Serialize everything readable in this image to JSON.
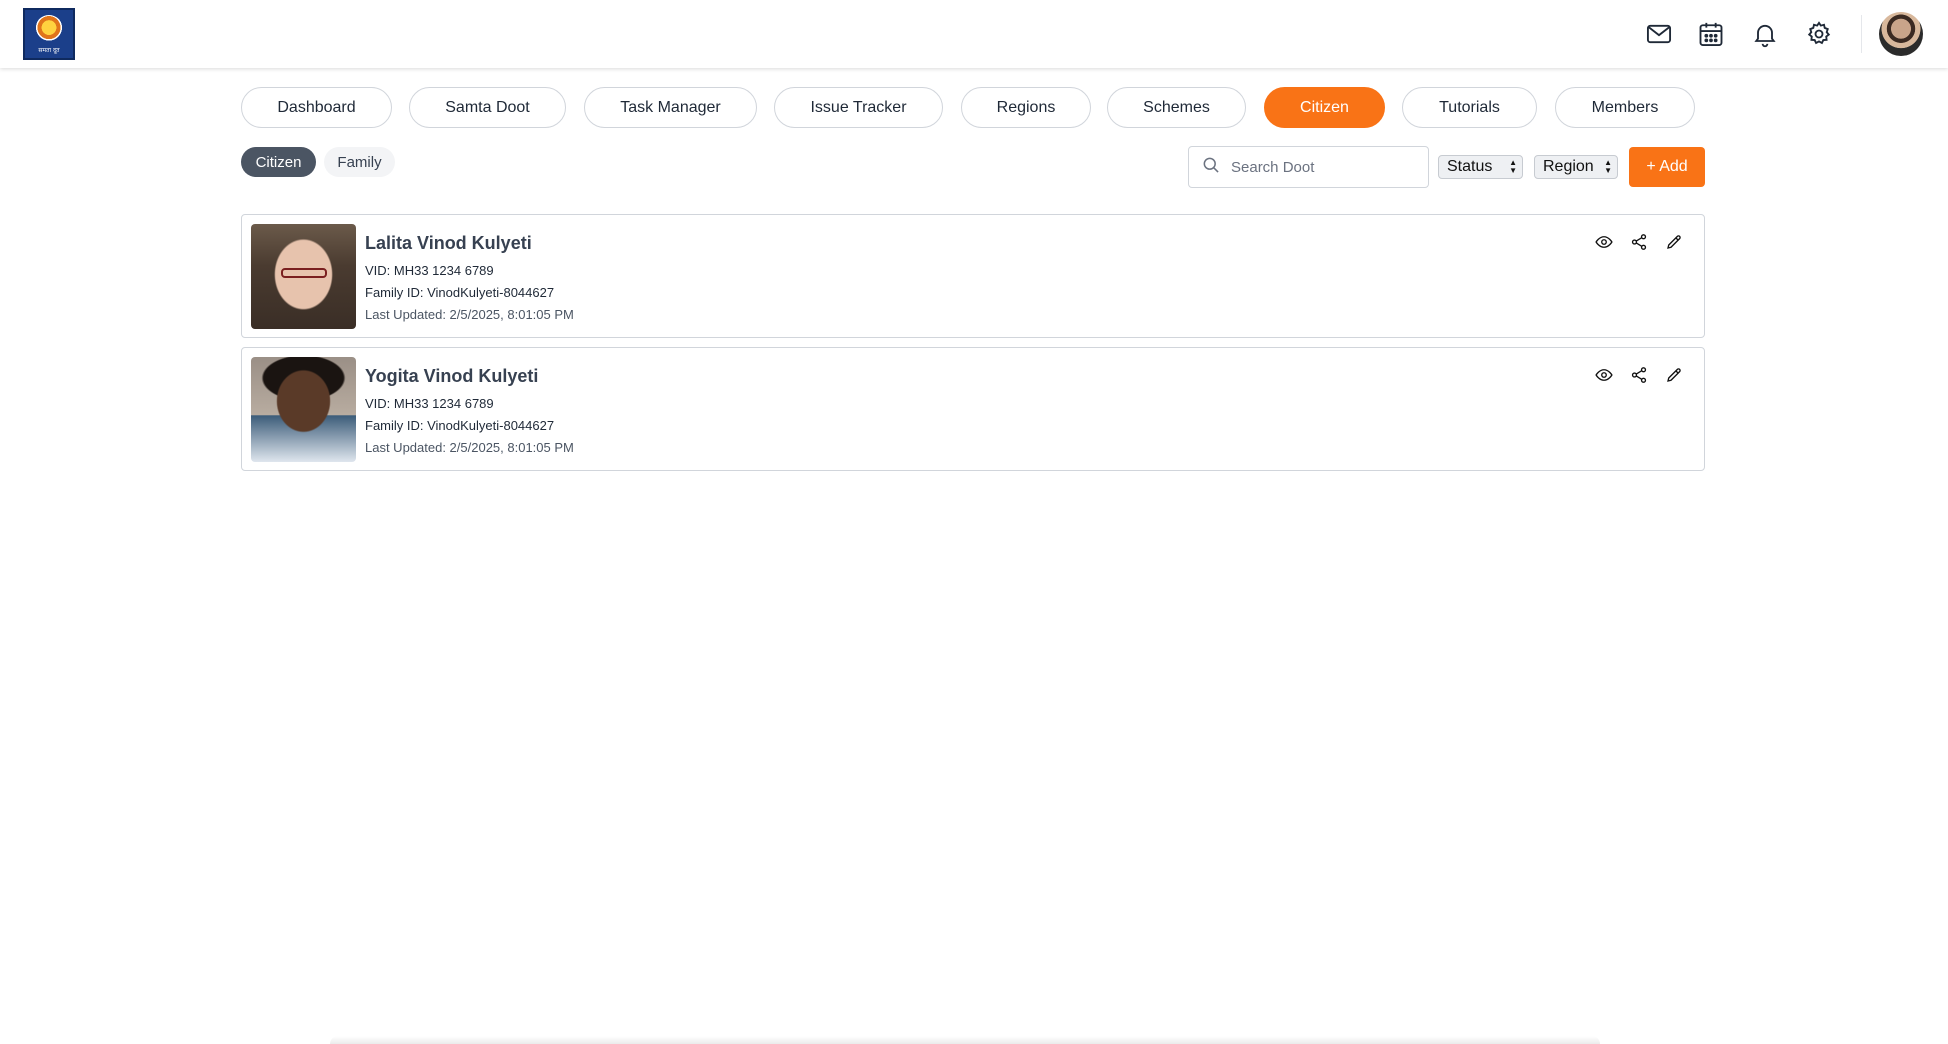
{
  "header": {
    "logo_text": "समता दूत",
    "icons": [
      "mail-icon",
      "calendar-icon",
      "bell-icon",
      "gear-icon"
    ]
  },
  "nav": {
    "tabs": [
      {
        "label": "Dashboard",
        "active": false
      },
      {
        "label": "Samta Doot",
        "active": false
      },
      {
        "label": "Task Manager",
        "active": false
      },
      {
        "label": "Issue Tracker",
        "active": false
      },
      {
        "label": "Regions",
        "active": false
      },
      {
        "label": "Schemes",
        "active": false
      },
      {
        "label": "Citizen",
        "active": true
      },
      {
        "label": "Tutorials",
        "active": false
      },
      {
        "label": "Members",
        "active": false
      }
    ]
  },
  "subtabs": [
    {
      "label": "Citizen",
      "active": true
    },
    {
      "label": "Family",
      "active": false
    }
  ],
  "toolbar": {
    "search_placeholder": "Search Doot",
    "status_label": "Status",
    "region_label": "Region",
    "add_label": "+ Add"
  },
  "citizens": [
    {
      "name": "Lalita Vinod Kulyeti",
      "vid": "VID: MH33 1234 6789",
      "family_id": "Family ID: VinodKulyeti-8044627",
      "last_updated": "Last Updated: 2/5/2025, 8:01:05 PM"
    },
    {
      "name": "Yogita Vinod Kulyeti",
      "vid": "VID: MH33 1234 6789",
      "family_id": "Family ID: VinodKulyeti-8044627",
      "last_updated": "Last Updated: 2/5/2025, 8:01:05 PM"
    }
  ],
  "colors": {
    "accent": "#f97316",
    "active_subtab": "#4b5563",
    "border": "#d1d5db"
  }
}
